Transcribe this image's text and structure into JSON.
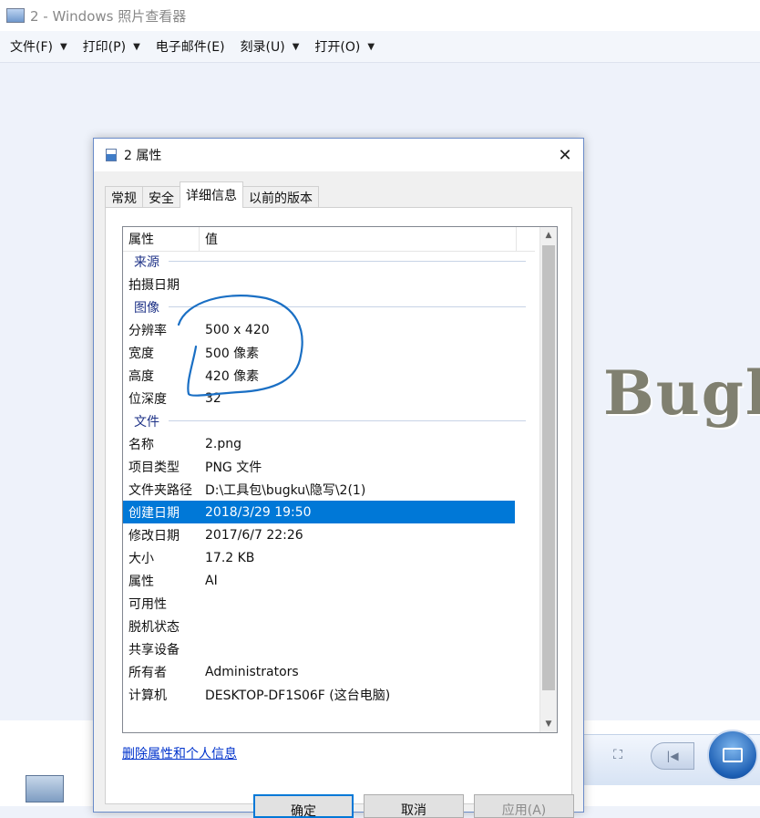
{
  "window": {
    "title": "2 - Windows 照片查看器"
  },
  "menu": {
    "items": [
      {
        "label": "文件(F)"
      },
      {
        "label": "打印(P)"
      },
      {
        "label": "电子邮件(E)"
      },
      {
        "label": "刻录(U)"
      },
      {
        "label": "打开(O)"
      }
    ]
  },
  "image": {
    "text": "Bugk"
  },
  "dialog": {
    "title": "2 属性",
    "tabs": [
      {
        "label": "常规"
      },
      {
        "label": "安全"
      },
      {
        "label": "详细信息",
        "active": true
      },
      {
        "label": "以前的版本"
      }
    ],
    "columns": {
      "property": "属性",
      "value": "值"
    },
    "rows": [
      {
        "kind": "group",
        "label": "来源"
      },
      {
        "kind": "prop",
        "key": "拍摄日期",
        "value": ""
      },
      {
        "kind": "group",
        "label": "图像"
      },
      {
        "kind": "prop",
        "key": "分辨率",
        "value": "500 x 420"
      },
      {
        "kind": "prop",
        "key": "宽度",
        "value": "500 像素"
      },
      {
        "kind": "prop",
        "key": "高度",
        "value": "420 像素"
      },
      {
        "kind": "prop",
        "key": "位深度",
        "value": "32"
      },
      {
        "kind": "group",
        "label": "文件"
      },
      {
        "kind": "prop",
        "key": "名称",
        "value": "2.png"
      },
      {
        "kind": "prop",
        "key": "项目类型",
        "value": "PNG 文件"
      },
      {
        "kind": "prop",
        "key": "文件夹路径",
        "value": "D:\\工具包\\bugku\\隐写\\2(1)"
      },
      {
        "kind": "prop",
        "key": "创建日期",
        "value": "2018/3/29 19:50",
        "selected": true
      },
      {
        "kind": "prop",
        "key": "修改日期",
        "value": "2017/6/7 22:26"
      },
      {
        "kind": "prop",
        "key": "大小",
        "value": "17.2 KB"
      },
      {
        "kind": "prop",
        "key": "属性",
        "value": "AI"
      },
      {
        "kind": "prop",
        "key": "可用性",
        "value": ""
      },
      {
        "kind": "prop",
        "key": "脱机状态",
        "value": ""
      },
      {
        "kind": "prop",
        "key": "共享设备",
        "value": ""
      },
      {
        "kind": "prop",
        "key": "所有者",
        "value": "Administrators"
      },
      {
        "kind": "prop",
        "key": "计算机",
        "value": "DESKTOP-DF1S06F (这台电脑)"
      }
    ],
    "remove_link": "删除属性和个人信息",
    "buttons": {
      "ok": "确定",
      "cancel": "取消",
      "apply": "应用(A)"
    }
  },
  "colors": {
    "selection": "#0078d7",
    "annotation_ink": "#1a6fc4",
    "group_text": "#1e3287",
    "link": "#0033cc"
  },
  "icons": {
    "window": "photo-viewer-icon",
    "dialog": "image-file-icon",
    "close": "close-icon",
    "menu_arrow": "dropdown-arrow-icon"
  }
}
